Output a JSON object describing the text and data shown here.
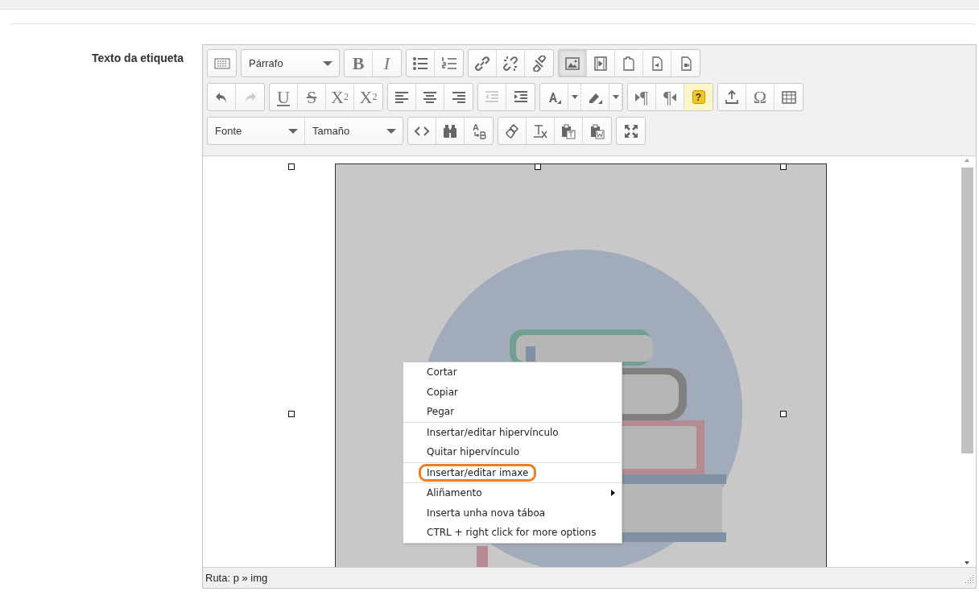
{
  "field_label": "Texto da etiqueta",
  "toolbar_rows": [
    [
      {
        "buttons": [
          {
            "kind": "toolbar-toggle"
          }
        ]
      },
      {
        "buttons": [
          {
            "kind": "dropdown",
            "label": "Párrafo"
          }
        ]
      },
      {
        "buttons": [
          {
            "kind": "bold",
            "label": "B"
          },
          {
            "kind": "italic",
            "label": "I"
          }
        ]
      },
      {
        "buttons": [
          {
            "kind": "bullets"
          },
          {
            "kind": "numbers"
          }
        ]
      },
      {
        "buttons": [
          {
            "kind": "link"
          },
          {
            "kind": "unlink"
          },
          {
            "kind": "anchor"
          }
        ]
      },
      {
        "buttons": [
          {
            "kind": "image",
            "selected": true
          },
          {
            "kind": "video",
            "selected": false
          },
          {
            "kind": "file",
            "selected": false
          },
          {
            "kind": "audio",
            "selected": false
          },
          {
            "kind": "media",
            "selected": false
          }
        ]
      }
    ],
    [
      {
        "buttons": [
          {
            "kind": "undo",
            "disabled": false
          },
          {
            "kind": "redo",
            "disabled": true
          }
        ]
      },
      {
        "buttons": [
          {
            "kind": "underline",
            "label": "U"
          },
          {
            "kind": "strike",
            "label": "S"
          },
          {
            "kind": "sub",
            "label": "X",
            "sub": "2"
          },
          {
            "kind": "sup",
            "label": "X",
            "sup": "2"
          }
        ]
      },
      {
        "buttons": [
          {
            "kind": "align-left"
          },
          {
            "kind": "align-center"
          },
          {
            "kind": "align-right"
          }
        ]
      },
      {
        "buttons": [
          {
            "kind": "outdent",
            "disabled": true
          },
          {
            "kind": "indent",
            "disabled": false
          }
        ]
      },
      {
        "buttons": [
          {
            "kind": "text-color"
          },
          {
            "kind": "split-arrow"
          },
          {
            "kind": "bg-color"
          },
          {
            "kind": "split-arrow"
          }
        ]
      },
      {
        "buttons": [
          {
            "kind": "ltr",
            "label": "¶"
          },
          {
            "kind": "rtl",
            "label": "¶"
          },
          {
            "kind": "help",
            "label": "?"
          }
        ]
      },
      {
        "buttons": [
          {
            "kind": "upload"
          },
          {
            "kind": "omega",
            "label": "Ω"
          },
          {
            "kind": "table"
          }
        ]
      }
    ],
    [
      {
        "buttons": [
          {
            "kind": "dropdown",
            "label": "Fonte"
          },
          {
            "kind": "dropdown",
            "label": "Tamaño"
          }
        ]
      },
      {
        "buttons": [
          {
            "kind": "code"
          },
          {
            "kind": "find"
          },
          {
            "kind": "replace"
          }
        ]
      },
      {
        "buttons": [
          {
            "kind": "brush"
          },
          {
            "kind": "clear-format"
          },
          {
            "kind": "paste-text"
          },
          {
            "kind": "paste-word"
          }
        ]
      },
      {
        "buttons": [
          {
            "kind": "fullscreen"
          }
        ]
      }
    ]
  ],
  "context_menu": [
    {
      "label": "Cortar",
      "separator_before": false,
      "highlighted": false,
      "has_submenu": false
    },
    {
      "label": "Copiar",
      "separator_before": false,
      "highlighted": false,
      "has_submenu": false
    },
    {
      "label": "Pegar",
      "separator_before": false,
      "highlighted": false,
      "has_submenu": false
    },
    {
      "label": "Insertar/editar hipervínculo",
      "separator_before": true,
      "highlighted": false,
      "has_submenu": false
    },
    {
      "label": "Quitar hipervínculo",
      "separator_before": false,
      "highlighted": false,
      "has_submenu": false
    },
    {
      "label": "Insertar/editar imaxe",
      "separator_before": true,
      "highlighted": true,
      "has_submenu": false
    },
    {
      "label": "Aliñamento",
      "separator_before": true,
      "highlighted": false,
      "has_submenu": true
    },
    {
      "label": "Inserta unha nova táboa",
      "separator_before": false,
      "highlighted": false,
      "has_submenu": false
    },
    {
      "label": "CTRL + right click for more options",
      "separator_before": false,
      "highlighted": false,
      "has_submenu": false
    }
  ],
  "status_bar": "Ruta: p » img"
}
